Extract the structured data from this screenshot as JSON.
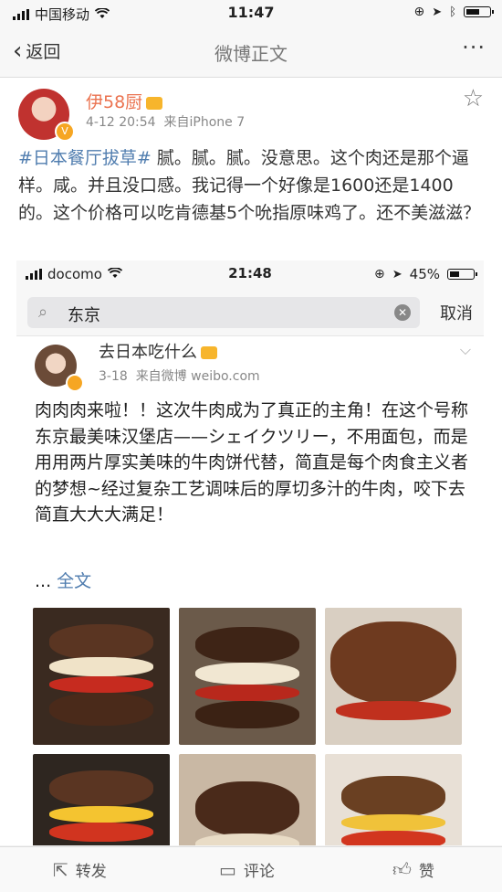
{
  "status_bar": {
    "carrier": "中国移动",
    "time": "11:47"
  },
  "nav": {
    "back_label": "返回",
    "title": "微博正文",
    "more_label": "···"
  },
  "post": {
    "author": "伊58厨",
    "time": "4-12 20:54",
    "source": "来自iPhone 7",
    "hashtag": "#日本餐厅拔草#",
    "body": " 腻。腻。腻。没意思。这个肉还是那个逼样。咸。并且没口感。我记得一个好像是1600还是1400的。这个价格可以吃肯德基5个吮指原味鸡了。还不美滋滋？"
  },
  "embedded": {
    "status_bar": {
      "carrier": "docomo",
      "time": "21:48",
      "battery": "45%"
    },
    "search": {
      "query": "东京",
      "cancel_label": "取消"
    },
    "post": {
      "author": "去日本吃什么",
      "time": "3-18",
      "source": "来自微博 weibo.com",
      "body": "肉肉肉来啦！！这次牛肉成为了真正的主角！在这个号称东京最美味汉堡店——シェイクツリー，不用面包，而是用用两片厚实美味的牛肉饼代替，简直是每个肉食主义者的梦想~经过复杂工艺调味后的厚切多汁的牛肉，咬下去简直大大大满足！",
      "ellipsis": "... ",
      "full_text_label": "全文"
    },
    "photos": [
      "burger-photo",
      "burger-photo",
      "burger-photo",
      "burger-photo",
      "burger-photo",
      "burger-photo"
    ]
  },
  "toolbar": {
    "repost_label": "转发",
    "comment_label": "评论",
    "like_label": "赞"
  },
  "colors": {
    "orange_name": "#eb7350",
    "link_blue": "#507daf"
  }
}
